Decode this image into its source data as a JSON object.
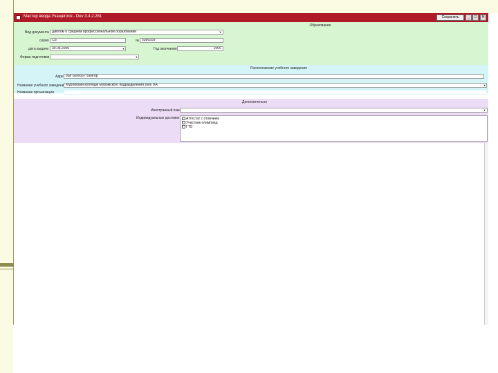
{
  "window": {
    "title": "Мастер ввода Учащегося - Dev 3.4.2.281",
    "save_label": "Сохранить",
    "minimize": "_",
    "maximize": "□",
    "close": "✕"
  },
  "education": {
    "heading": "Образование",
    "doc_type_label": "Вид документа",
    "doc_type_value": "Диплом о среднем профессиональном образовании",
    "series_label": "серия",
    "series_value": "СБ",
    "number_label": "№",
    "number_value": "5386259",
    "issue_date_label": "дата выдачи",
    "issue_date_value": "30.06.2006",
    "grad_year_label": "Год окончания",
    "grad_year_value": "2006",
    "prep_form_label": "Форма подготовки",
    "prep_form_value": ""
  },
  "location": {
    "heading": "Расположение учебного заведения",
    "address_label": "Адрес",
    "address_value": "обл Белгор г Белгор",
    "institution_label": "Название учебного заведения",
    "institution_value": "Муромский колледж Муромского подразделения БелГНА",
    "address_doc_label": "Название организации",
    "address_doc_value": ""
  },
  "additional": {
    "heading": "Дополнительно",
    "foreign_lang_label": "Иностранный язык",
    "foreign_lang_value": "",
    "achievements_label": "Индивидуальные достижения",
    "achievements": [
      "Аттестат с отличием",
      "Участник олимпиад",
      "ГТО"
    ]
  }
}
